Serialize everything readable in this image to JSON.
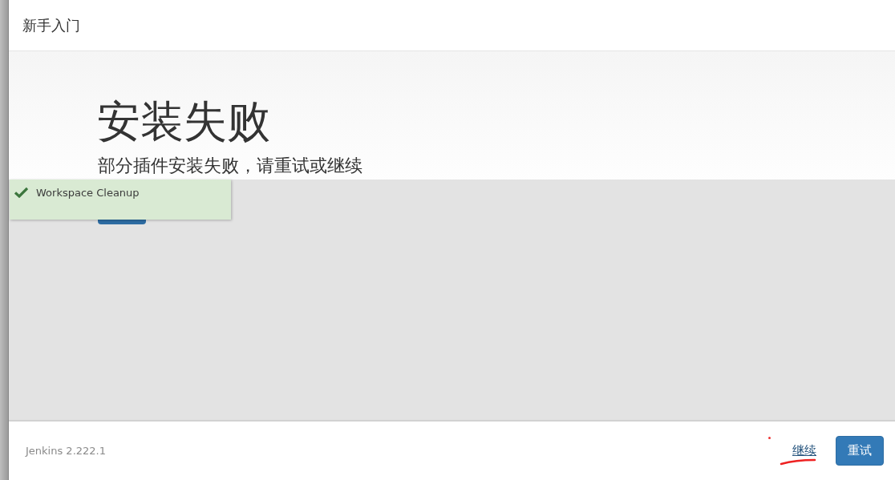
{
  "header": {
    "title": "新手入门"
  },
  "main": {
    "heading": "安装失败",
    "subtitle": "部分插件安装失败，请重试或继续"
  },
  "toast": {
    "text": "Workspace Cleanup",
    "success": true
  },
  "footer": {
    "version": "Jenkins 2.222.1",
    "continue_link": "继续",
    "retry_button": "重试"
  }
}
